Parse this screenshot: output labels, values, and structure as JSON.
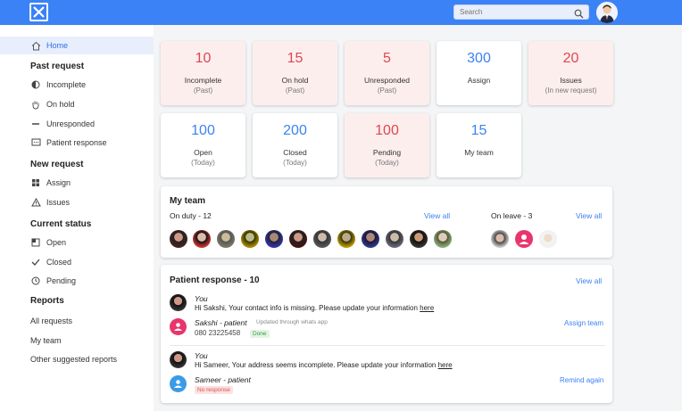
{
  "header": {
    "search_placeholder": "Search"
  },
  "sidebar": {
    "home": "Home",
    "sections": [
      {
        "title": "Past request",
        "items": [
          "Incomplete",
          "On hold",
          "Unresponded",
          "Patient response"
        ]
      },
      {
        "title": "New request",
        "items": [
          "Assign",
          "Issues"
        ]
      },
      {
        "title": "Current status",
        "items": [
          "Open",
          "Closed",
          "Pending"
        ]
      },
      {
        "title": "Reports",
        "items": [
          "All requests",
          "My team",
          "Other suggested reports"
        ]
      }
    ]
  },
  "cards": [
    {
      "value": "10",
      "label": "Incomplete",
      "sub": "(Past)"
    },
    {
      "value": "15",
      "label": "On hold",
      "sub": "(Past)"
    },
    {
      "value": "5",
      "label": "Unresponded",
      "sub": "(Past)"
    },
    {
      "value": "300",
      "label": "Assign",
      "sub": ""
    },
    {
      "value": "20",
      "label": "Issues",
      "sub": "(In new request)"
    },
    {
      "value": "100",
      "label": "Open",
      "sub": "(Today)"
    },
    {
      "value": "200",
      "label": "Closed",
      "sub": "(Today)"
    },
    {
      "value": "100",
      "label": "Pending",
      "sub": "(Today)"
    },
    {
      "value": "15",
      "label": "My team",
      "sub": ""
    }
  ],
  "team": {
    "title": "My team",
    "on_duty": "On duty - 12",
    "view_all": "View all",
    "on_leave": "On leave - 3",
    "view_all_leave": "View all"
  },
  "responses": {
    "title": "Patient response - 10",
    "view_all": "View all",
    "items": [
      {
        "sender": "You",
        "message": "Hi Sakshi, Your contact info is missing. Please update your information",
        "link": "here",
        "patient": "Sakshi - patient",
        "note": "Updated through whats app",
        "phone": "080 23225458",
        "status": "Done",
        "action": "Assign team"
      },
      {
        "sender": "You",
        "message": "Hi Sameer, Your address seems incomplete. Please update your information",
        "link": "here",
        "patient": "Sameer - patient",
        "status": "No response",
        "action": "Remind again"
      }
    ]
  }
}
